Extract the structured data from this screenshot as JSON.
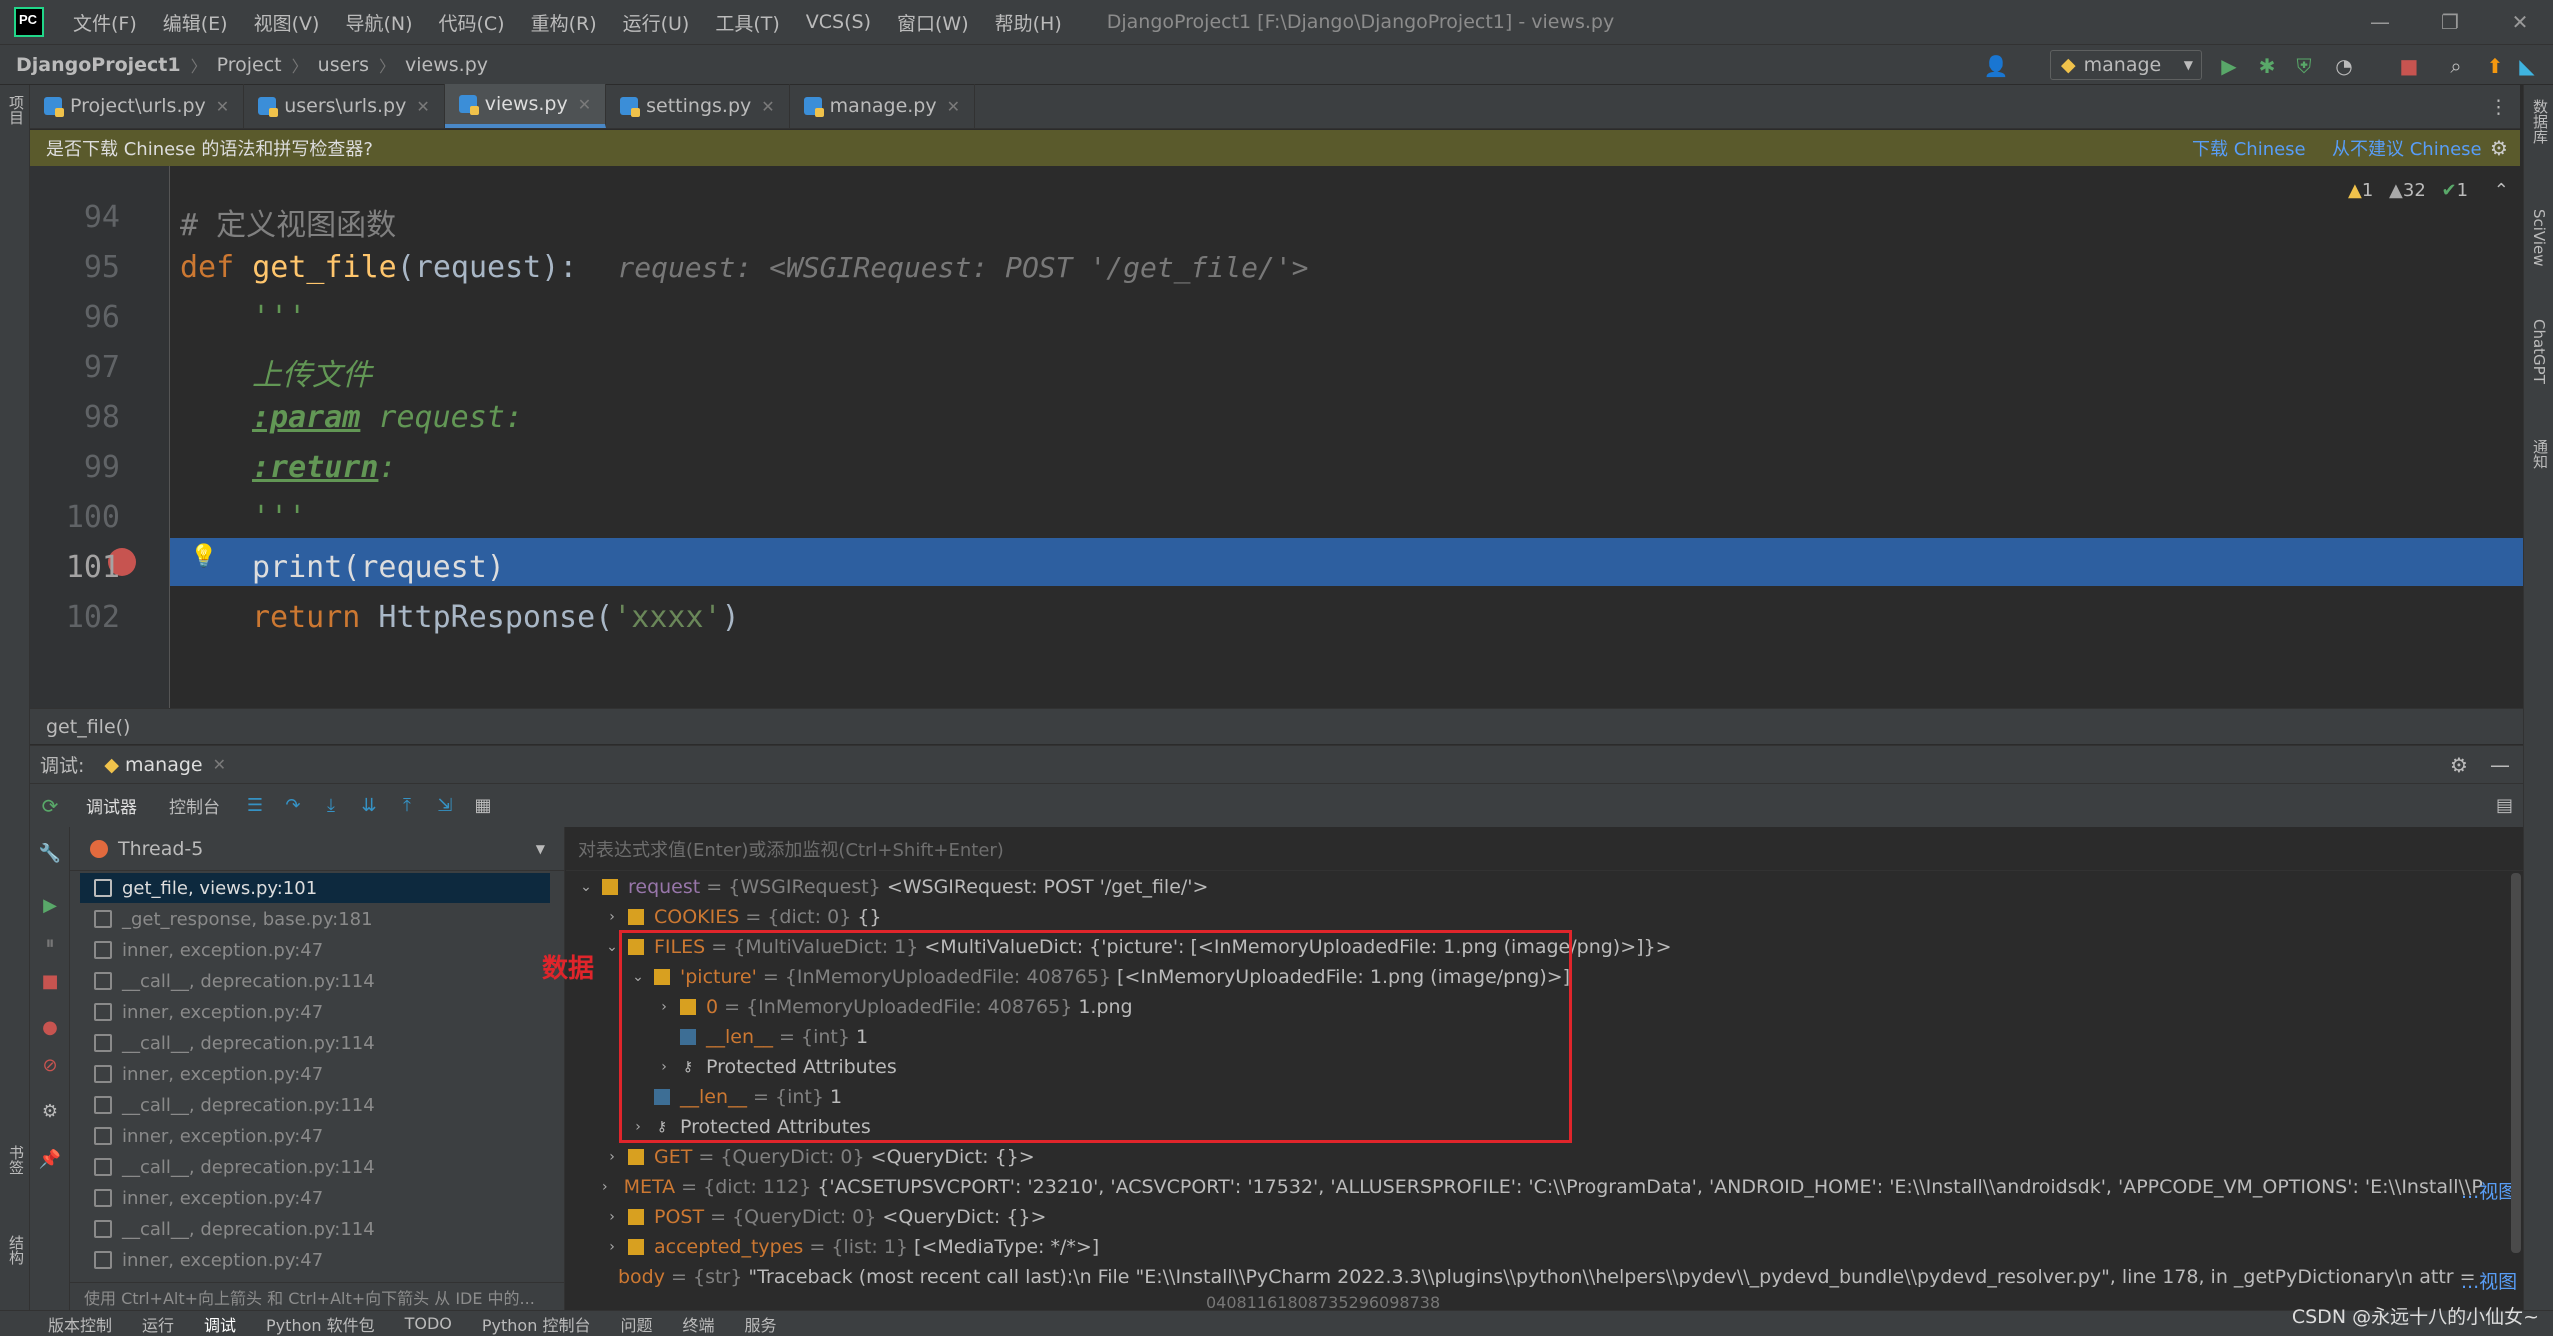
{
  "menu": [
    "文件(F)",
    "编辑(E)",
    "视图(V)",
    "导航(N)",
    "代码(C)",
    "重构(R)",
    "运行(U)",
    "工具(T)",
    "VCS(S)",
    "窗口(W)",
    "帮助(H)"
  ],
  "window_title": "DjangoProject1 [F:\\Django\\DjangoProject1] - views.py",
  "breadcrumbs": [
    "DjangoProject1",
    "Project",
    "users",
    "views.py"
  ],
  "run_config": "manage",
  "tabs": [
    "Project\\urls.py",
    "users\\urls.py",
    "views.py",
    "settings.py",
    "manage.py"
  ],
  "notification": {
    "text": "是否下载 Chinese 的语法和拼写检查器?",
    "download": "下载 Chinese",
    "never": "从不建议 Chinese"
  },
  "inspections": {
    "warn1": "1",
    "warn2": "32",
    "ok": "1"
  },
  "code": {
    "lines": [
      "94",
      "95",
      "96",
      "97",
      "98",
      "99",
      "100",
      "101",
      "102"
    ],
    "l94": "# 定义视图函数",
    "l95_def": "def",
    "l95_fn": "get_file",
    "l95_args": "(request):",
    "l95_hint": "request: <WSGIRequest: POST '/get_file/'>",
    "l96": "'''",
    "l97": "上传文件",
    "l98_tag": ":param",
    "l98_rest": " request:",
    "l99_tag": ":return",
    "l99_rest": ":",
    "l100": "'''",
    "l101": "print(request)",
    "l102_kw": "return",
    "l102_fn": " HttpResponse(",
    "l102_str": "'xxxx'",
    "l102_end": ")"
  },
  "current_function": "get_file()",
  "debug": {
    "label": "调试:",
    "session": "manage",
    "tab_debugger": "调试器",
    "tab_console": "控制台",
    "thread": "Thread-5",
    "eval_placeholder": "对表达式求值(Enter)或添加监视(Ctrl+Shift+Enter)",
    "frames": [
      "get_file, views.py:101",
      "_get_response, base.py:181",
      "inner, exception.py:47",
      "__call__, deprecation.py:114",
      "inner, exception.py:47",
      "__call__, deprecation.py:114",
      "inner, exception.py:47",
      "__call__, deprecation.py:114",
      "inner, exception.py:47",
      "__call__, deprecation.py:114",
      "inner, exception.py:47",
      "__call__, deprecation.py:114",
      "inner, exception.py:47"
    ],
    "frames_hint": "使用 Ctrl+Alt+向上箭头 和 Ctrl+Alt+向下箭头 从 IDE 中的..."
  },
  "vars": {
    "request": {
      "name": "request",
      "type": "{WSGIRequest}",
      "value": "<WSGIRequest: POST '/get_file/'>"
    },
    "cookies": {
      "name": "COOKIES",
      "type": "{dict: 0}",
      "value": "{}"
    },
    "files": {
      "name": "FILES",
      "type": "{MultiValueDict: 1}",
      "value": "<MultiValueDict: {'picture': [<InMemoryUploadedFile: 1.png (image/png)>]}>"
    },
    "picture": {
      "name": "'picture'",
      "type": "{InMemoryUploadedFile: 408765}",
      "value": "[<InMemoryUploadedFile: 1.png (image/png)>]"
    },
    "item0": {
      "name": "0",
      "type": "{InMemoryUploadedFile: 408765}",
      "value": "1.png"
    },
    "len_inner": {
      "name": "__len__",
      "type": "{int}",
      "value": "1"
    },
    "prot_inner": "Protected Attributes",
    "len_outer": {
      "name": "__len__",
      "type": "{int}",
      "value": "1"
    },
    "prot_outer": "Protected Attributes",
    "get": {
      "name": "GET",
      "type": "{QueryDict: 0}",
      "value": "<QueryDict: {}>"
    },
    "meta": {
      "name": "META",
      "type": "{dict: 112}",
      "value": "{'ACSETUPSVCPORT': '23210', 'ACSVCPORT': '17532', 'ALLUSERSPROFILE': 'C:\\\\ProgramData', 'ANDROID_HOME': 'E:\\\\Install\\\\androidsdk', 'APPCODE_VM_OPTIONS': 'E:\\\\Install\\\\PyCharm 2022...."
    },
    "post": {
      "name": "POST",
      "type": "{QueryDict: 0}",
      "value": "<QueryDict: {}>"
    },
    "accepted": {
      "name": "accepted_types",
      "type": "{list: 1}",
      "value": "[<MediaType: */*>]"
    },
    "body": {
      "name": "body",
      "type": "{str}",
      "value": "\"Traceback (most recent call last):\\n  File \"E:\\\\Install\\\\PyCharm 2022.3.3\\\\plugins\\\\python\\\\helpers\\\\pydev\\\\_pydevd_bundle\\\\pydevd_resolver.py\", line 178, in _getPyDictionary\\n    attr = getattr(var, r..."
    },
    "view_link": "...视图",
    "partial": "04081161808735296098738"
  },
  "annotation_label": "数据",
  "bottom_tabs": [
    "版本控制",
    "运行",
    "调试",
    "Python 软件包",
    "TODO",
    "Python 控制台",
    "问题",
    "终端",
    "服务"
  ],
  "watermark": "CSDN @永远十八的小仙女~",
  "side_left": [
    "项目",
    "书签",
    "结构"
  ],
  "side_right": [
    "数据库",
    "SciView",
    "ChatGPT",
    "通知"
  ]
}
